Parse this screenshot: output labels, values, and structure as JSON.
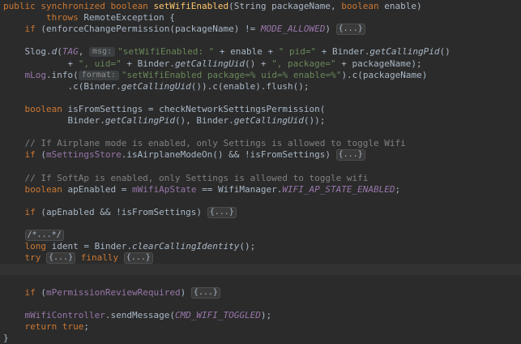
{
  "editor": {
    "lines": [
      {
        "segments": [
          {
            "t": "public synchronized boolean ",
            "c": "kw"
          },
          {
            "t": "setWifiEnabled",
            "c": "fn"
          },
          {
            "t": "(String packageName, "
          },
          {
            "t": "boolean ",
            "c": "kw"
          },
          {
            "t": "enable)"
          }
        ]
      },
      {
        "segments": [
          {
            "t": "        "
          },
          {
            "t": "throws ",
            "c": "kw"
          },
          {
            "t": "RemoteException {"
          }
        ]
      },
      {
        "segments": [
          {
            "t": "    "
          },
          {
            "t": "if ",
            "c": "kw"
          },
          {
            "t": "(enforceChangePermission(packageName) != "
          },
          {
            "t": "MODE_ALLOWED",
            "c": "fld-i"
          },
          {
            "t": ") "
          },
          {
            "t": "{...}",
            "c": "fold"
          }
        ]
      },
      {
        "segments": []
      },
      {
        "segments": [
          {
            "t": "    Slog."
          },
          {
            "t": "d",
            "c": "call-i"
          },
          {
            "t": "("
          },
          {
            "t": "TAG",
            "c": "fld-i"
          },
          {
            "t": ", "
          },
          {
            "t": "msg:",
            "c": "hint"
          },
          {
            "t": "\"setWifiEnabled: \" ",
            "c": "str"
          },
          {
            "t": "+ enable + "
          },
          {
            "t": "\" pid=\" ",
            "c": "str"
          },
          {
            "t": "+ Binder."
          },
          {
            "t": "getCallingPid",
            "c": "call-i"
          },
          {
            "t": "()"
          }
        ]
      },
      {
        "segments": [
          {
            "t": "            + "
          },
          {
            "t": "\", uid=\" ",
            "c": "str"
          },
          {
            "t": "+ Binder."
          },
          {
            "t": "getCallingUid",
            "c": "call-i"
          },
          {
            "t": "() + "
          },
          {
            "t": "\", package=\" ",
            "c": "str"
          },
          {
            "t": "+ packageName);"
          }
        ]
      },
      {
        "segments": [
          {
            "t": "    "
          },
          {
            "t": "mLog",
            "c": "fld"
          },
          {
            "t": ".info("
          },
          {
            "t": "format:",
            "c": "hint"
          },
          {
            "t": "\"setWifiEnabled package=% uid=% enable=%\"",
            "c": "str"
          },
          {
            "t": ").c(packageName)"
          }
        ]
      },
      {
        "segments": [
          {
            "t": "            .c(Binder."
          },
          {
            "t": "getCallingUid",
            "c": "call-i"
          },
          {
            "t": "()).c(enable).flush();"
          }
        ]
      },
      {
        "segments": []
      },
      {
        "segments": [
          {
            "t": "    "
          },
          {
            "t": "boolean ",
            "c": "kw"
          },
          {
            "t": "isFromSettings = checkNetworkSettingsPermission("
          }
        ]
      },
      {
        "segments": [
          {
            "t": "            Binder."
          },
          {
            "t": "getCallingPid",
            "c": "call-i"
          },
          {
            "t": "(), Binder."
          },
          {
            "t": "getCallingUid",
            "c": "call-i"
          },
          {
            "t": "());"
          }
        ]
      },
      {
        "segments": []
      },
      {
        "segments": [
          {
            "t": "    // If Airplane mode is enabled, only Settings is allowed to toggle Wifi",
            "c": "cm"
          }
        ]
      },
      {
        "segments": [
          {
            "t": "    "
          },
          {
            "t": "if ",
            "c": "kw"
          },
          {
            "t": "("
          },
          {
            "t": "mSettingsStore",
            "c": "fld"
          },
          {
            "t": ".isAirplaneModeOn() && !isFromSettings) "
          },
          {
            "t": "{...}",
            "c": "fold"
          }
        ]
      },
      {
        "segments": []
      },
      {
        "segments": [
          {
            "t": "    // If SoftAp is enabled, only Settings is allowed to toggle wifi",
            "c": "cm"
          }
        ]
      },
      {
        "segments": [
          {
            "t": "    "
          },
          {
            "t": "boolean ",
            "c": "kw"
          },
          {
            "t": "apEnabled = "
          },
          {
            "t": "mWifiApState",
            "c": "fld"
          },
          {
            "t": " == WifiManager."
          },
          {
            "t": "WIFI_AP_STATE_ENABLED",
            "c": "fld-i"
          },
          {
            "t": ";"
          }
        ]
      },
      {
        "segments": []
      },
      {
        "segments": [
          {
            "t": "    "
          },
          {
            "t": "if ",
            "c": "kw"
          },
          {
            "t": "(apEnabled && !isFromSettings) "
          },
          {
            "t": "{...}",
            "c": "fold"
          }
        ]
      },
      {
        "segments": []
      },
      {
        "segments": [
          {
            "t": "    "
          },
          {
            "t": "/*...*/",
            "c": "fold"
          }
        ]
      },
      {
        "segments": [
          {
            "t": "    "
          },
          {
            "t": "long ",
            "c": "kw"
          },
          {
            "t": "ident = Binder."
          },
          {
            "t": "clearCallingIdentity",
            "c": "call-i"
          },
          {
            "t": "();"
          }
        ]
      },
      {
        "segments": [
          {
            "t": "    "
          },
          {
            "t": "try ",
            "c": "kw"
          },
          {
            "t": "{...}",
            "c": "fold"
          },
          {
            "t": " "
          },
          {
            "t": "finally ",
            "c": "kw"
          },
          {
            "t": "{...}",
            "c": "fold"
          }
        ]
      },
      {
        "segments": []
      },
      {
        "segments": []
      },
      {
        "segments": [
          {
            "t": "    "
          },
          {
            "t": "if ",
            "c": "kw"
          },
          {
            "t": "("
          },
          {
            "t": "mPermissionReviewRequired",
            "c": "fld"
          },
          {
            "t": ") "
          },
          {
            "t": "{...}",
            "c": "fold"
          }
        ]
      },
      {
        "segments": []
      },
      {
        "segments": [
          {
            "t": "    "
          },
          {
            "t": "mWifiController",
            "c": "fld"
          },
          {
            "t": ".sendMessage("
          },
          {
            "t": "CMD_WIFI_TOGGLED",
            "c": "fld-i"
          },
          {
            "t": ");"
          }
        ]
      },
      {
        "segments": [
          {
            "t": "    "
          },
          {
            "t": "return true",
            "c": "kw"
          },
          {
            "t": ";"
          }
        ]
      },
      {
        "segments": [
          {
            "t": "}"
          }
        ]
      }
    ]
  }
}
